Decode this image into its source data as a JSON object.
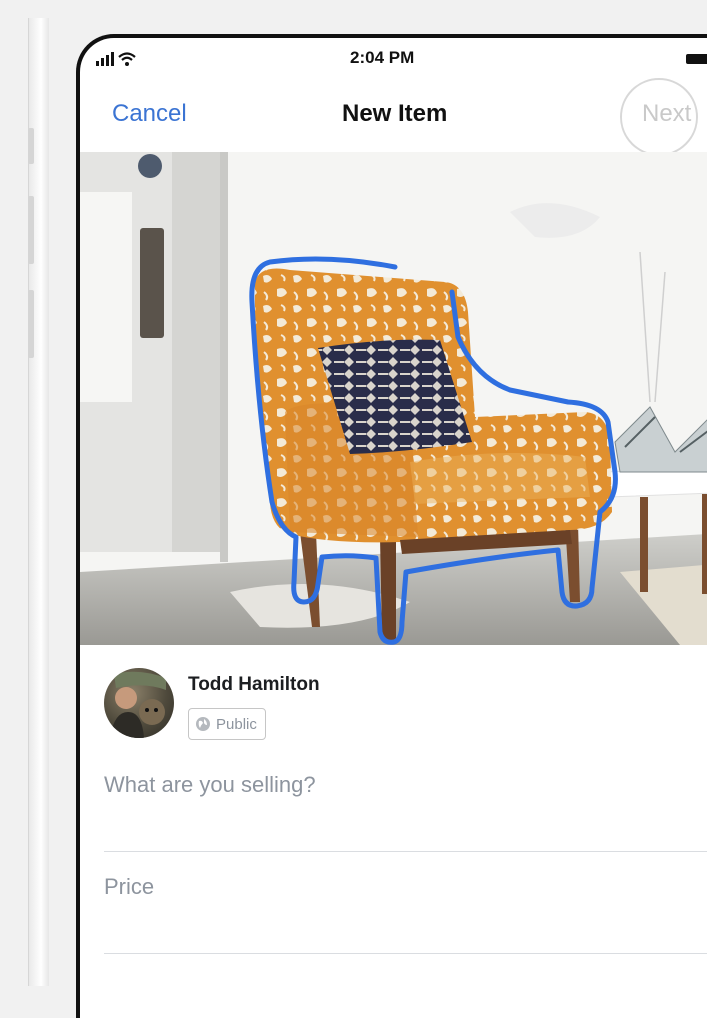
{
  "status_bar": {
    "time": "2:04 PM"
  },
  "nav": {
    "cancel_label": "Cancel",
    "title": "New Item",
    "next_label": "Next"
  },
  "post": {
    "user_name": "Todd Hamilton",
    "privacy_label": "Public"
  },
  "form": {
    "item_placeholder": "What are you selling?",
    "price_placeholder": "Price"
  },
  "colors": {
    "accent": "#3b74d3",
    "outline": "#2f6fe0",
    "chair_fabric": "#e0902f",
    "disabled_text": "#c9c9c9"
  },
  "icons": [
    "signal-icon",
    "wifi-icon",
    "battery-icon",
    "globe-icon"
  ]
}
